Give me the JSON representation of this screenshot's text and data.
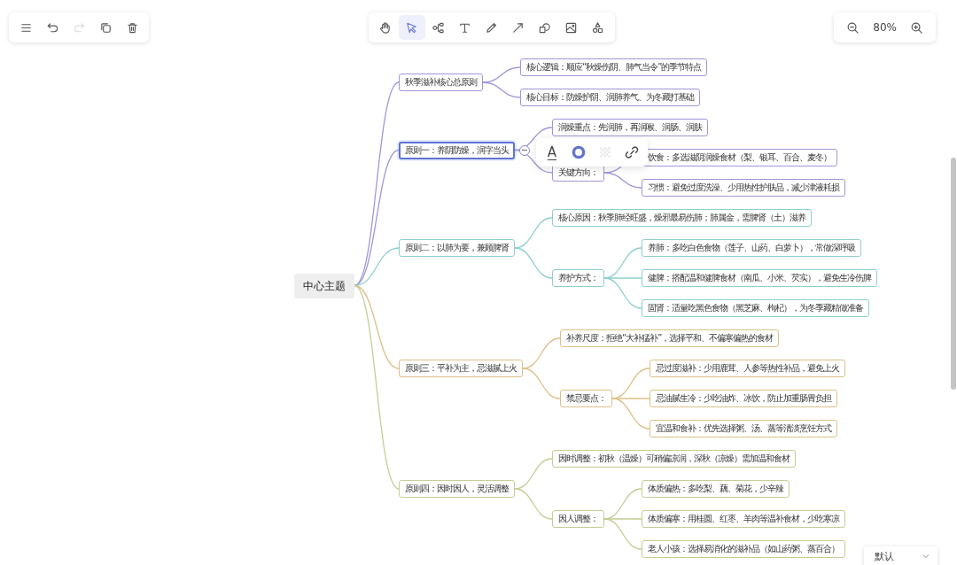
{
  "toolbar_left": [
    {
      "kind": "menu",
      "disabled": false
    },
    {
      "kind": "undo",
      "disabled": false
    },
    {
      "kind": "redo",
      "disabled": true
    },
    {
      "kind": "copy",
      "disabled": false
    },
    {
      "kind": "delete",
      "disabled": false
    }
  ],
  "toolbar_center": [
    {
      "kind": "hand",
      "selected": false
    },
    {
      "kind": "select",
      "selected": true
    },
    {
      "kind": "mindmap",
      "selected": false
    },
    {
      "kind": "text",
      "selected": false
    },
    {
      "kind": "pen",
      "selected": false
    },
    {
      "kind": "arrow",
      "selected": false
    },
    {
      "kind": "shapes",
      "selected": false
    },
    {
      "kind": "image",
      "selected": false
    },
    {
      "kind": "more-shapes",
      "selected": false
    }
  ],
  "zoom": {
    "value": "80%"
  },
  "mindmap": {
    "text": "中心主题",
    "selected": false,
    "children": [
      {
        "text": "秋季滋补核心总原则",
        "color": "#9d98d8",
        "selected": false,
        "children": [
          {
            "text": "核心逻辑：顺应“秋燥伤阴、肺气当令”的季节特点",
            "selected": false
          },
          {
            "text": "核心目标：防燥护阴、润肺养气、为冬藏打基础",
            "selected": false
          }
        ]
      },
      {
        "text": "原则一：养阴防燥，润字当头",
        "color": "#9d98d8",
        "selected": true,
        "children": [
          {
            "text": "润燥重点：先润肺，再润喉、润肠、润肤",
            "selected": false
          },
          {
            "text": "关键方向：",
            "selected": false,
            "children": [
              {
                "text": "饮食：多选滋阴润燥食材（梨、银耳、百合、麦冬）",
                "selected": false
              },
              {
                "text": "习惯：避免过度洗澡、少用热性护肤品，减少津液耗损",
                "selected": false
              }
            ]
          }
        ]
      },
      {
        "text": "原则二：以肺为要，兼顾脾肾",
        "color": "#8ecfd0",
        "selected": false,
        "children": [
          {
            "text": "核心原因：秋季肺经旺盛，燥邪最易伤肺；肺属金，需脾肾（土）滋养",
            "selected": false
          },
          {
            "text": "养护方式：",
            "selected": false,
            "children": [
              {
                "text": "养肺：多吃白色食物（莲子、山药、白萝卜），常做深呼吸",
                "selected": false
              },
              {
                "text": "健脾：搭配温和健脾食材（南瓜、小米、芡实），避免生冷伤脾",
                "selected": false
              },
              {
                "text": "固肾：适量吃黑色食物（黑芝麻、枸杞），为冬季藏精做准备",
                "selected": false
              }
            ]
          }
        ]
      },
      {
        "text": "原则三：平补为主，忌滋腻上火",
        "color": "#dcc087",
        "selected": false,
        "children": [
          {
            "text": "补养尺度：拒绝“大补猛补”，选择平和、不偏寒偏热的食材",
            "selected": false
          },
          {
            "text": "禁忌要点：",
            "selected": false,
            "children": [
              {
                "text": "忌过度滋补：少用鹿茸、人参等热性补品，避免上火",
                "selected": false
              },
              {
                "text": "忌油腻生冷：少吃油炸、冰饮，防止加重肠胃负担",
                "selected": false
              },
              {
                "text": "宜温和食补：优先选择粥、汤、蒸等清淡烹饪方式",
                "selected": false
              }
            ]
          }
        ]
      },
      {
        "text": "原则四：因时因人，灵活调整",
        "color": "#c4cd95",
        "selected": false,
        "children": [
          {
            "text": "因时调整：初秋（温燥）可稍偏凉润，深秋（凉燥）需加温和食材",
            "selected": false
          },
          {
            "text": "因人调整：",
            "selected": false,
            "children": [
              {
                "text": "体质偏热：多吃梨、藕、菊花，少辛辣",
                "selected": false
              },
              {
                "text": "体质偏寒：用桂圆、红枣、羊肉等温补食材，少吃寒凉",
                "selected": false
              },
              {
                "text": "老人小孩：选择易消化的滋补品（如山药粥、蒸百合）",
                "selected": false
              }
            ]
          }
        ]
      }
    ]
  },
  "node_toolbar": [
    {
      "kind": "text-style",
      "glyph": "A",
      "disabled": false
    },
    {
      "kind": "border",
      "disabled": false
    },
    {
      "kind": "fill",
      "disabled": true
    },
    {
      "kind": "link",
      "disabled": false
    }
  ],
  "theme_select": {
    "value": "默认"
  }
}
